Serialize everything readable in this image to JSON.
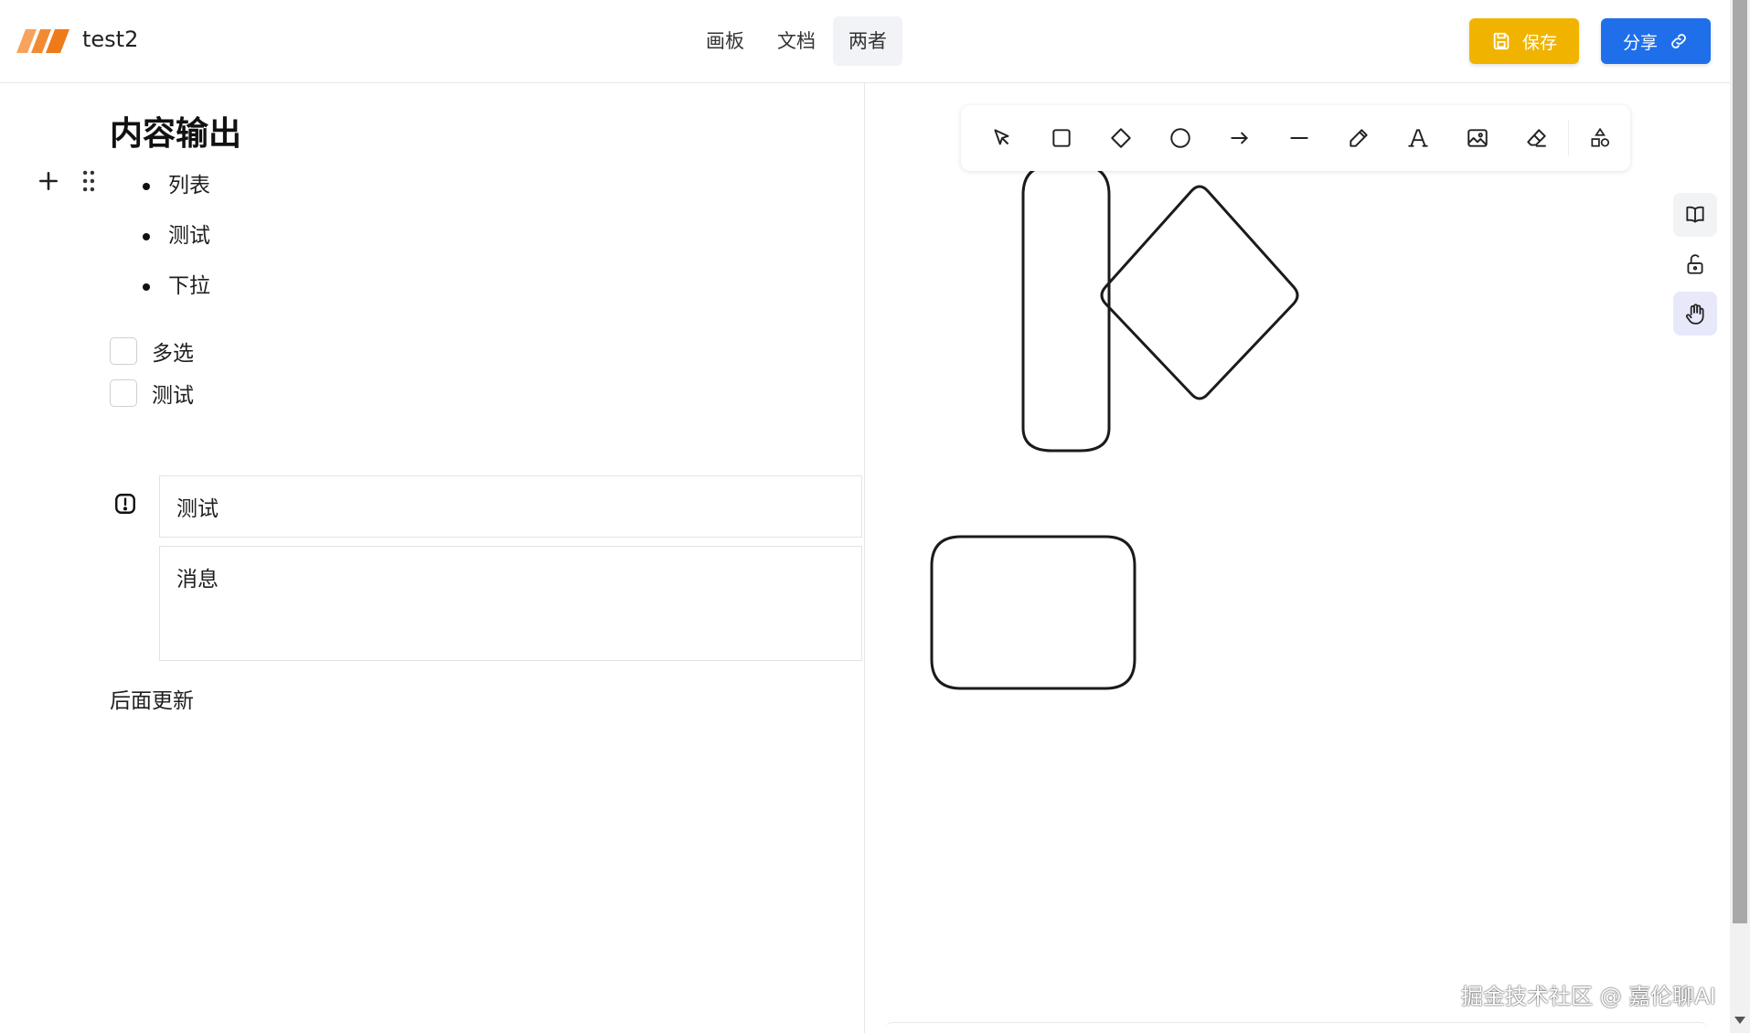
{
  "header": {
    "title": "test2",
    "tabs": [
      {
        "label": "画板"
      },
      {
        "label": "文档"
      },
      {
        "label": "两者",
        "active": true
      }
    ],
    "save_label": "保存",
    "share_label": "分享",
    "save_color": "#f0b400",
    "share_color": "#1f6feb"
  },
  "doc": {
    "title": "内容输出",
    "bullets": [
      "列表",
      "测试",
      "下拉"
    ],
    "checklist": [
      {
        "label": "多选",
        "checked": false
      },
      {
        "label": "测试",
        "checked": false
      }
    ],
    "alert": {
      "title": "测试",
      "message": "消息"
    },
    "footer": "后面更新"
  },
  "canvas": {
    "tools": [
      "select-icon",
      "rectangle-icon",
      "diamond-icon",
      "ellipse-icon",
      "arrow-icon",
      "line-icon",
      "pencil-icon",
      "text-icon",
      "image-icon",
      "eraser-icon",
      "shapes-library-icon"
    ],
    "side_tools": [
      "library-book-icon",
      "unlock-icon",
      "hand-icon"
    ],
    "shapes": [
      "tall-rounded-rectangle",
      "diamond",
      "wide-rounded-rectangle"
    ]
  },
  "watermark": "掘金技术社区 @ 嘉伦聊AI"
}
